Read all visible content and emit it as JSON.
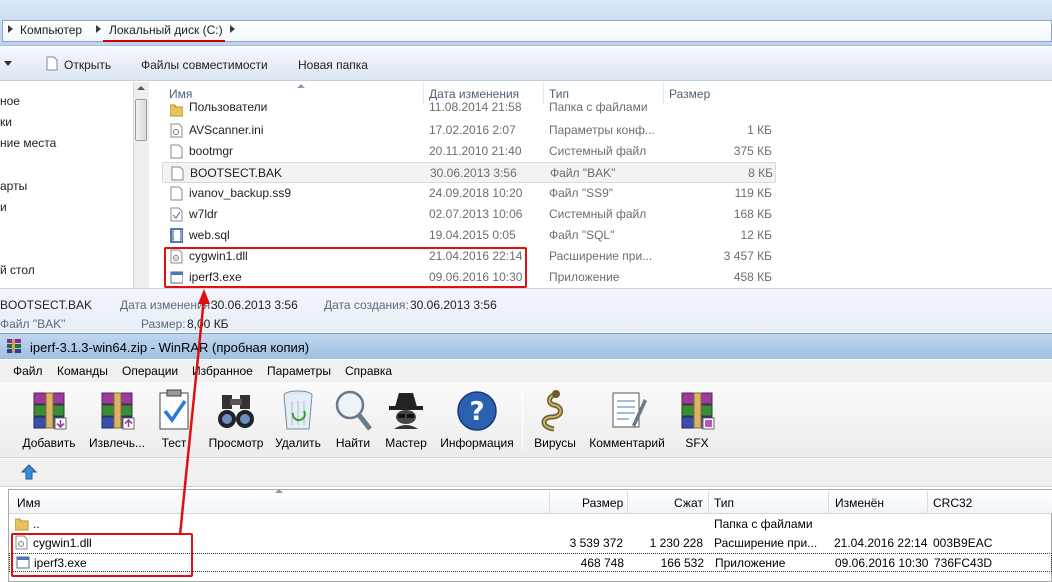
{
  "explorer": {
    "breadcrumb": [
      "Компьютер",
      "Локальный диск (C:)"
    ],
    "toolbar": {
      "open": "Открыть",
      "compat": "Файлы совместимости",
      "new_folder": "Новая папка"
    },
    "nav_items": [
      "ное",
      "ки",
      "ние места",
      "арты",
      "и",
      "й стол"
    ],
    "columns": {
      "name": "Имя",
      "date": "Дата изменения",
      "type": "Тип",
      "size": "Размер"
    },
    "files": [
      {
        "name": "Пользователи",
        "date": "11.08.2014 21:58",
        "type": "Папка с файлами",
        "size": "",
        "icon": "folder-icon"
      },
      {
        "name": "AVScanner.ini",
        "date": "17.02.2016 2:07",
        "type": "Параметры конф...",
        "size": "1 КБ",
        "icon": "settings-file-icon"
      },
      {
        "name": "bootmgr",
        "date": "20.11.2010 21:40",
        "type": "Системный файл",
        "size": "375 КБ",
        "icon": "file-icon"
      },
      {
        "name": "BOOTSECT.BAK",
        "date": "30.06.2013 3:56",
        "type": "Файл \"BAK\"",
        "size": "8 КБ",
        "icon": "file-icon"
      },
      {
        "name": "ivanov_backup.ss9",
        "date": "24.09.2018 10:20",
        "type": "Файл \"SS9\"",
        "size": "119 КБ",
        "icon": "file-icon"
      },
      {
        "name": "w7ldr",
        "date": "02.07.2013 10:06",
        "type": "Системный файл",
        "size": "168 КБ",
        "icon": "system-file-icon"
      },
      {
        "name": "web.sql",
        "date": "19.04.2015 0:05",
        "type": "Файл \"SQL\"",
        "size": "12 КБ",
        "icon": "sql-file-icon"
      },
      {
        "name": "cygwin1.dll",
        "date": "21.04.2016 22:14",
        "type": "Расширение при...",
        "size": "3 457 КБ",
        "icon": "dll-file-icon"
      },
      {
        "name": "iperf3.exe",
        "date": "09.06.2016 10:30",
        "type": "Приложение",
        "size": "458 КБ",
        "icon": "exe-file-icon"
      }
    ],
    "details": {
      "name": "BOOTSECT.BAK",
      "modified_label": "Дата изменения:",
      "modified": "30.06.2013 3:56",
      "created_label": "Дата создания:",
      "created": "30.06.2013 3:56",
      "type": "Файл \"BAK\"",
      "size_label": "Размер:",
      "size": "8,00 КБ"
    }
  },
  "winrar": {
    "title": "iperf-3.1.3-win64.zip - WinRAR (пробная копия)",
    "menu": [
      "Файл",
      "Команды",
      "Операции",
      "Избранное",
      "Параметры",
      "Справка"
    ],
    "tools": [
      {
        "label": "Добавить",
        "icon": "add-archive-icon"
      },
      {
        "label": "Извлечь...",
        "icon": "extract-icon"
      },
      {
        "label": "Тест",
        "icon": "test-icon"
      },
      {
        "label": "Просмотр",
        "icon": "view-icon"
      },
      {
        "label": "Удалить",
        "icon": "delete-icon"
      },
      {
        "label": "Найти",
        "icon": "find-icon"
      },
      {
        "label": "Мастер",
        "icon": "wizard-icon"
      },
      {
        "label": "Информация",
        "icon": "info-icon"
      },
      {
        "label": "Вирусы",
        "icon": "virus-scan-icon"
      },
      {
        "label": "Комментарий",
        "icon": "comment-icon"
      },
      {
        "label": "SFX",
        "icon": "sfx-icon"
      }
    ],
    "columns": {
      "name": "Имя",
      "size": "Размер",
      "packed": "Сжат",
      "type": "Тип",
      "modified": "Изменён",
      "crc": "CRC32"
    },
    "rows": [
      {
        "name": "..",
        "size": "",
        "packed": "",
        "type": "Папка с файлами",
        "modified": "",
        "crc": "",
        "icon": "folder-icon"
      },
      {
        "name": "cygwin1.dll",
        "size": "3 539 372",
        "packed": "1 230 228",
        "type": "Расширение при...",
        "modified": "21.04.2016 22:14",
        "crc": "003B9EAC",
        "icon": "dll-file-icon"
      },
      {
        "name": "iperf3.exe",
        "size": "468 748",
        "packed": "166 532",
        "type": "Приложение",
        "modified": "09.06.2016 10:30",
        "crc": "736FC43D",
        "icon": "exe-file-icon"
      }
    ]
  }
}
